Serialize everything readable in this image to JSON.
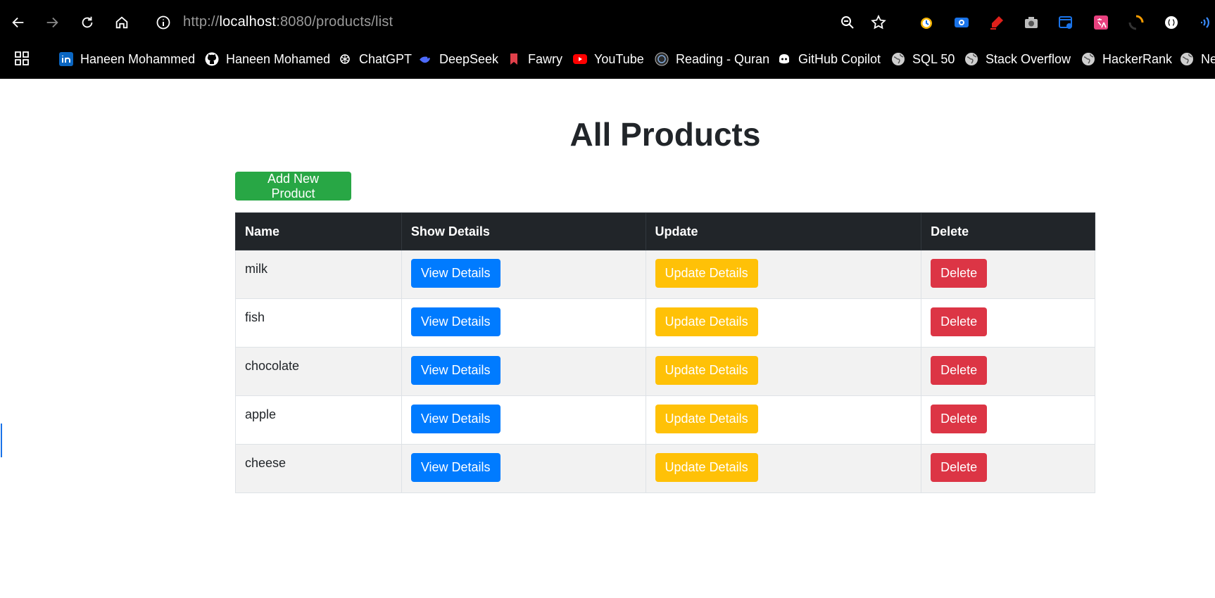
{
  "browser": {
    "url_prefix": "http://",
    "url_host": "localhost",
    "url_rest": ":8080/products/list",
    "bookmarks": [
      {
        "label": "Haneen Mohammed",
        "icon": "linkedin-icon"
      },
      {
        "label": "Haneen Mohamed",
        "icon": "github-icon"
      },
      {
        "label": "ChatGPT",
        "icon": "chatgpt-icon"
      },
      {
        "label": "DeepSeek",
        "icon": "deepseek-icon"
      },
      {
        "label": "Fawry",
        "icon": "bookmark-icon"
      },
      {
        "label": "YouTube",
        "icon": "youtube-icon"
      },
      {
        "label": "Reading - Quran",
        "icon": "quran-icon"
      },
      {
        "label": "GitHub Copilot",
        "icon": "copilot-icon"
      },
      {
        "label": "SQL 50",
        "icon": "globe-icon"
      },
      {
        "label": "Stack Overflow",
        "icon": "globe-icon"
      },
      {
        "label": "HackerRank",
        "icon": "globe-icon"
      },
      {
        "label": "Ne",
        "icon": "globe-icon"
      }
    ]
  },
  "page": {
    "title": "All Products",
    "add_button": "Add New Product"
  },
  "table": {
    "headers": [
      "Name",
      "Show Details",
      "Update",
      "Delete"
    ],
    "rows": [
      {
        "name": "milk",
        "view": "View Details",
        "update": "Update Details",
        "delete": "Delete"
      },
      {
        "name": "fish",
        "view": "View Details",
        "update": "Update Details",
        "delete": "Delete"
      },
      {
        "name": "chocolate",
        "view": "View Details",
        "update": "Update Details",
        "delete": "Delete"
      },
      {
        "name": "apple",
        "view": "View Details",
        "update": "Update Details",
        "delete": "Delete"
      },
      {
        "name": "cheese",
        "view": "View Details",
        "update": "Update Details",
        "delete": "Delete"
      }
    ]
  },
  "colors": {
    "success": "#28a745",
    "primary": "#007bff",
    "warning": "#ffc107",
    "danger": "#dc3545",
    "table_header": "#212529"
  }
}
